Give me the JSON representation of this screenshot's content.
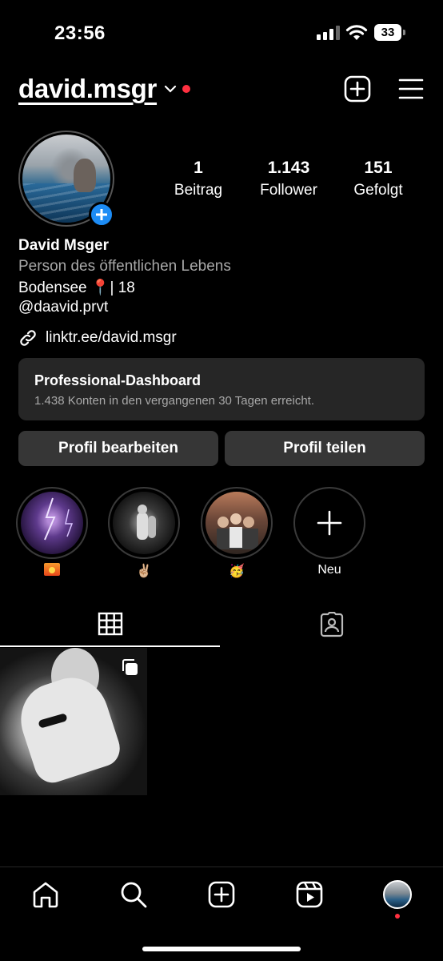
{
  "status_bar": {
    "time": "23:56",
    "battery": "33"
  },
  "header": {
    "username": "david.msgr"
  },
  "profile": {
    "stats": [
      {
        "value": "1",
        "label": "Beitrag"
      },
      {
        "value": "1.143",
        "label": "Follower"
      },
      {
        "value": "151",
        "label": "Gefolgt"
      }
    ],
    "name": "David Msger",
    "category": "Person des öffentlichen Lebens",
    "bio_line1": "Bodensee 📍| 18",
    "bio_line2": "@daavid.prvt",
    "link": "linktr.ee/david.msgr"
  },
  "dashboard": {
    "title": "Professional-Dashboard",
    "subtitle": "1.438 Konten in den vergangenen 30 Tagen erreicht."
  },
  "buttons": {
    "edit": "Profil bearbeiten",
    "share": "Profil teilen"
  },
  "highlights": [
    {
      "label_emoji": "sunset"
    },
    {
      "label": "✌🏼"
    },
    {
      "label": "🥳"
    },
    {
      "label": "Neu"
    }
  ],
  "tabs": {
    "active": "grid"
  },
  "colors": {
    "background": "#000000",
    "surface": "#262626",
    "button": "#363636",
    "accent": "#1d8cf5",
    "notification": "#ff3040"
  }
}
